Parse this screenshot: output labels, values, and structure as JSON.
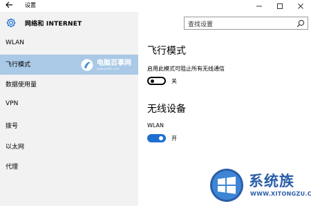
{
  "window": {
    "title": "设置"
  },
  "sidebar": {
    "header": "网络和 INTERNET",
    "items": [
      {
        "label": "WLAN",
        "active": false
      },
      {
        "label": "飞行模式",
        "active": true
      },
      {
        "label": "数据使用量",
        "active": false
      },
      {
        "label": "VPN",
        "active": false
      },
      {
        "label": "拨号",
        "active": false
      },
      {
        "label": "以太网",
        "active": false
      },
      {
        "label": "代理",
        "active": false
      }
    ],
    "watermark": {
      "name": "电脑百事网",
      "url": "www.pc841.com"
    }
  },
  "search": {
    "placeholder": "查找设置"
  },
  "main": {
    "airplane": {
      "heading": "飞行模式",
      "description": "启用此模式可阻止所有无线通信",
      "state_label": "关",
      "on": false
    },
    "wireless": {
      "heading": "无线设备",
      "wlan_label": "WLAN",
      "state_label": "开",
      "on": true
    }
  },
  "watermark": {
    "brand": "系统族",
    "url": "WWW.XITONGZU.COM"
  },
  "colors": {
    "accent": "#1e6fcf",
    "selected": "#a9c9e6",
    "sidebar_bg": "#f2f2f2"
  }
}
